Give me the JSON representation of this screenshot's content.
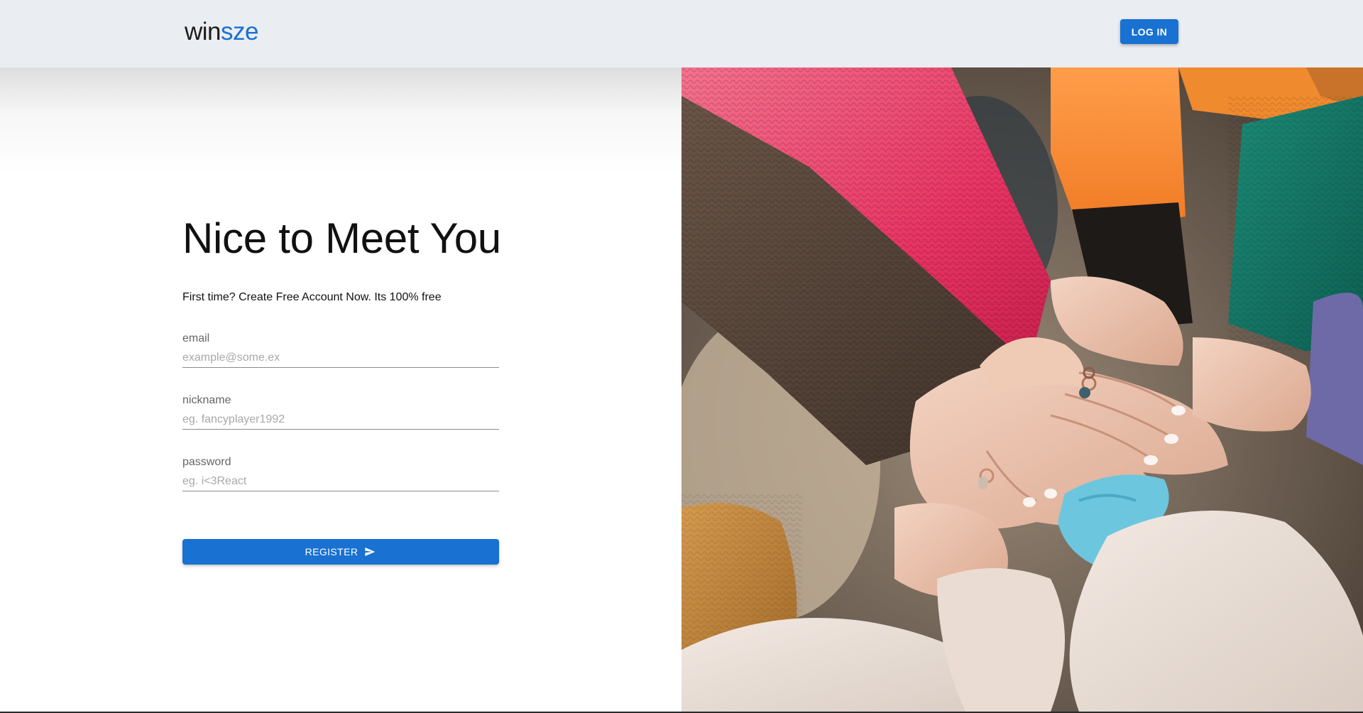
{
  "header": {
    "logo_part1": "win",
    "logo_part2": "sze",
    "login_label": "LOG IN"
  },
  "form": {
    "heading": "Nice to Meet You",
    "subtitle": "First time? Create Free Account Now. Its 100% free",
    "fields": [
      {
        "label": "email",
        "placeholder": "example@some.ex",
        "value": ""
      },
      {
        "label": "nickname",
        "placeholder": "eg. fancyplayer1992",
        "value": ""
      },
      {
        "label": "password",
        "placeholder": "eg. i<3React",
        "value": ""
      }
    ],
    "register_label": "REGISTER",
    "register_icon": "send-icon"
  },
  "hero": {
    "image_icon": "hands-together-photo"
  },
  "colors": {
    "brand": "#1971d2",
    "header_bg": "#eaedf1"
  }
}
